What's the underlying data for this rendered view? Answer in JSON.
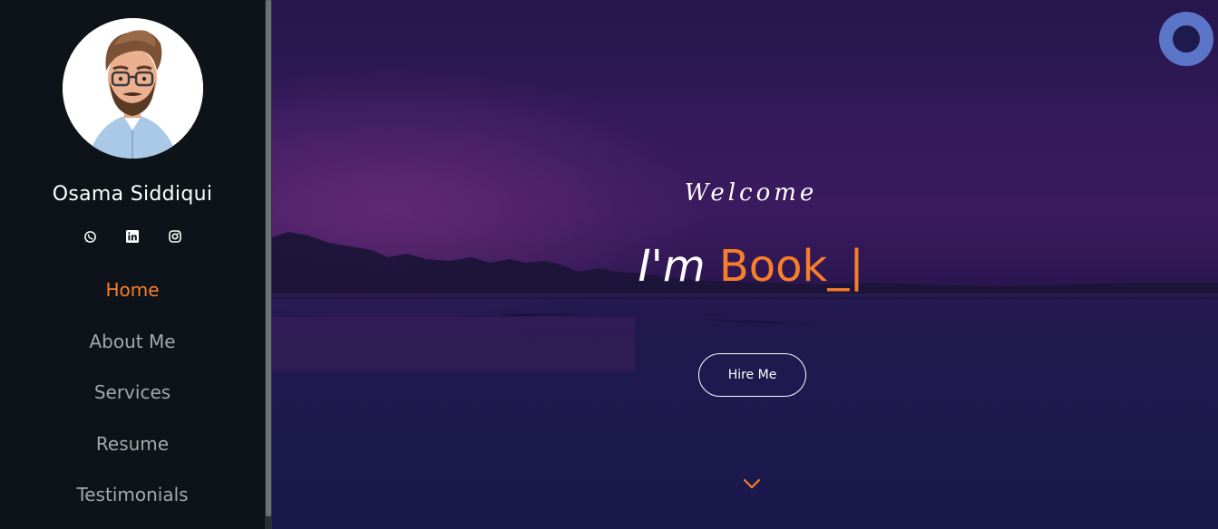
{
  "profile": {
    "name": "Osama Siddiqui",
    "avatar_icon": "avatar-illustration"
  },
  "socials": [
    {
      "icon": "whatsapp-icon"
    },
    {
      "icon": "linkedin-icon"
    },
    {
      "icon": "instagram-icon"
    }
  ],
  "nav": {
    "items": [
      {
        "label": "Home",
        "active": true
      },
      {
        "label": "About Me",
        "active": false
      },
      {
        "label": "Services",
        "active": false
      },
      {
        "label": "Resume",
        "active": false
      },
      {
        "label": "Testimonials",
        "active": false
      }
    ]
  },
  "hero": {
    "welcome": "Welcome",
    "prefix": "I'm ",
    "typed": "Book_|",
    "hire_label": "Hire Me",
    "scroll_icon": "chevron-down-icon"
  },
  "colors": {
    "accent": "#f67f2a",
    "sidebar_bg": "#0d1318",
    "loader": "#5b76c9"
  }
}
